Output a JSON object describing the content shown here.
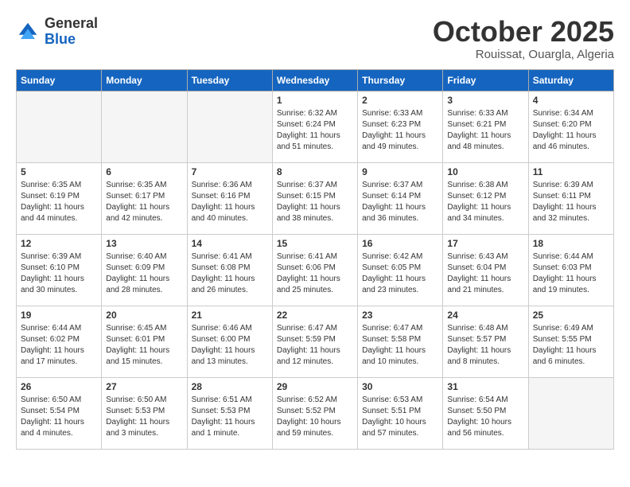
{
  "header": {
    "logo_general": "General",
    "logo_blue": "Blue",
    "month": "October 2025",
    "location": "Rouissat, Ouargla, Algeria"
  },
  "days_of_week": [
    "Sunday",
    "Monday",
    "Tuesday",
    "Wednesday",
    "Thursday",
    "Friday",
    "Saturday"
  ],
  "weeks": [
    [
      {
        "day": "",
        "sunrise": "",
        "sunset": "",
        "daylight": "",
        "empty": true
      },
      {
        "day": "",
        "sunrise": "",
        "sunset": "",
        "daylight": "",
        "empty": true
      },
      {
        "day": "",
        "sunrise": "",
        "sunset": "",
        "daylight": "",
        "empty": true
      },
      {
        "day": "1",
        "sunrise": "Sunrise: 6:32 AM",
        "sunset": "Sunset: 6:24 PM",
        "daylight": "Daylight: 11 hours and 51 minutes.",
        "empty": false
      },
      {
        "day": "2",
        "sunrise": "Sunrise: 6:33 AM",
        "sunset": "Sunset: 6:23 PM",
        "daylight": "Daylight: 11 hours and 49 minutes.",
        "empty": false
      },
      {
        "day": "3",
        "sunrise": "Sunrise: 6:33 AM",
        "sunset": "Sunset: 6:21 PM",
        "daylight": "Daylight: 11 hours and 48 minutes.",
        "empty": false
      },
      {
        "day": "4",
        "sunrise": "Sunrise: 6:34 AM",
        "sunset": "Sunset: 6:20 PM",
        "daylight": "Daylight: 11 hours and 46 minutes.",
        "empty": false
      }
    ],
    [
      {
        "day": "5",
        "sunrise": "Sunrise: 6:35 AM",
        "sunset": "Sunset: 6:19 PM",
        "daylight": "Daylight: 11 hours and 44 minutes.",
        "empty": false
      },
      {
        "day": "6",
        "sunrise": "Sunrise: 6:35 AM",
        "sunset": "Sunset: 6:17 PM",
        "daylight": "Daylight: 11 hours and 42 minutes.",
        "empty": false
      },
      {
        "day": "7",
        "sunrise": "Sunrise: 6:36 AM",
        "sunset": "Sunset: 6:16 PM",
        "daylight": "Daylight: 11 hours and 40 minutes.",
        "empty": false
      },
      {
        "day": "8",
        "sunrise": "Sunrise: 6:37 AM",
        "sunset": "Sunset: 6:15 PM",
        "daylight": "Daylight: 11 hours and 38 minutes.",
        "empty": false
      },
      {
        "day": "9",
        "sunrise": "Sunrise: 6:37 AM",
        "sunset": "Sunset: 6:14 PM",
        "daylight": "Daylight: 11 hours and 36 minutes.",
        "empty": false
      },
      {
        "day": "10",
        "sunrise": "Sunrise: 6:38 AM",
        "sunset": "Sunset: 6:12 PM",
        "daylight": "Daylight: 11 hours and 34 minutes.",
        "empty": false
      },
      {
        "day": "11",
        "sunrise": "Sunrise: 6:39 AM",
        "sunset": "Sunset: 6:11 PM",
        "daylight": "Daylight: 11 hours and 32 minutes.",
        "empty": false
      }
    ],
    [
      {
        "day": "12",
        "sunrise": "Sunrise: 6:39 AM",
        "sunset": "Sunset: 6:10 PM",
        "daylight": "Daylight: 11 hours and 30 minutes.",
        "empty": false
      },
      {
        "day": "13",
        "sunrise": "Sunrise: 6:40 AM",
        "sunset": "Sunset: 6:09 PM",
        "daylight": "Daylight: 11 hours and 28 minutes.",
        "empty": false
      },
      {
        "day": "14",
        "sunrise": "Sunrise: 6:41 AM",
        "sunset": "Sunset: 6:08 PM",
        "daylight": "Daylight: 11 hours and 26 minutes.",
        "empty": false
      },
      {
        "day": "15",
        "sunrise": "Sunrise: 6:41 AM",
        "sunset": "Sunset: 6:06 PM",
        "daylight": "Daylight: 11 hours and 25 minutes.",
        "empty": false
      },
      {
        "day": "16",
        "sunrise": "Sunrise: 6:42 AM",
        "sunset": "Sunset: 6:05 PM",
        "daylight": "Daylight: 11 hours and 23 minutes.",
        "empty": false
      },
      {
        "day": "17",
        "sunrise": "Sunrise: 6:43 AM",
        "sunset": "Sunset: 6:04 PM",
        "daylight": "Daylight: 11 hours and 21 minutes.",
        "empty": false
      },
      {
        "day": "18",
        "sunrise": "Sunrise: 6:44 AM",
        "sunset": "Sunset: 6:03 PM",
        "daylight": "Daylight: 11 hours and 19 minutes.",
        "empty": false
      }
    ],
    [
      {
        "day": "19",
        "sunrise": "Sunrise: 6:44 AM",
        "sunset": "Sunset: 6:02 PM",
        "daylight": "Daylight: 11 hours and 17 minutes.",
        "empty": false
      },
      {
        "day": "20",
        "sunrise": "Sunrise: 6:45 AM",
        "sunset": "Sunset: 6:01 PM",
        "daylight": "Daylight: 11 hours and 15 minutes.",
        "empty": false
      },
      {
        "day": "21",
        "sunrise": "Sunrise: 6:46 AM",
        "sunset": "Sunset: 6:00 PM",
        "daylight": "Daylight: 11 hours and 13 minutes.",
        "empty": false
      },
      {
        "day": "22",
        "sunrise": "Sunrise: 6:47 AM",
        "sunset": "Sunset: 5:59 PM",
        "daylight": "Daylight: 11 hours and 12 minutes.",
        "empty": false
      },
      {
        "day": "23",
        "sunrise": "Sunrise: 6:47 AM",
        "sunset": "Sunset: 5:58 PM",
        "daylight": "Daylight: 11 hours and 10 minutes.",
        "empty": false
      },
      {
        "day": "24",
        "sunrise": "Sunrise: 6:48 AM",
        "sunset": "Sunset: 5:57 PM",
        "daylight": "Daylight: 11 hours and 8 minutes.",
        "empty": false
      },
      {
        "day": "25",
        "sunrise": "Sunrise: 6:49 AM",
        "sunset": "Sunset: 5:55 PM",
        "daylight": "Daylight: 11 hours and 6 minutes.",
        "empty": false
      }
    ],
    [
      {
        "day": "26",
        "sunrise": "Sunrise: 6:50 AM",
        "sunset": "Sunset: 5:54 PM",
        "daylight": "Daylight: 11 hours and 4 minutes.",
        "empty": false
      },
      {
        "day": "27",
        "sunrise": "Sunrise: 6:50 AM",
        "sunset": "Sunset: 5:53 PM",
        "daylight": "Daylight: 11 hours and 3 minutes.",
        "empty": false
      },
      {
        "day": "28",
        "sunrise": "Sunrise: 6:51 AM",
        "sunset": "Sunset: 5:53 PM",
        "daylight": "Daylight: 11 hours and 1 minute.",
        "empty": false
      },
      {
        "day": "29",
        "sunrise": "Sunrise: 6:52 AM",
        "sunset": "Sunset: 5:52 PM",
        "daylight": "Daylight: 10 hours and 59 minutes.",
        "empty": false
      },
      {
        "day": "30",
        "sunrise": "Sunrise: 6:53 AM",
        "sunset": "Sunset: 5:51 PM",
        "daylight": "Daylight: 10 hours and 57 minutes.",
        "empty": false
      },
      {
        "day": "31",
        "sunrise": "Sunrise: 6:54 AM",
        "sunset": "Sunset: 5:50 PM",
        "daylight": "Daylight: 10 hours and 56 minutes.",
        "empty": false
      },
      {
        "day": "",
        "sunrise": "",
        "sunset": "",
        "daylight": "",
        "empty": true
      }
    ]
  ]
}
